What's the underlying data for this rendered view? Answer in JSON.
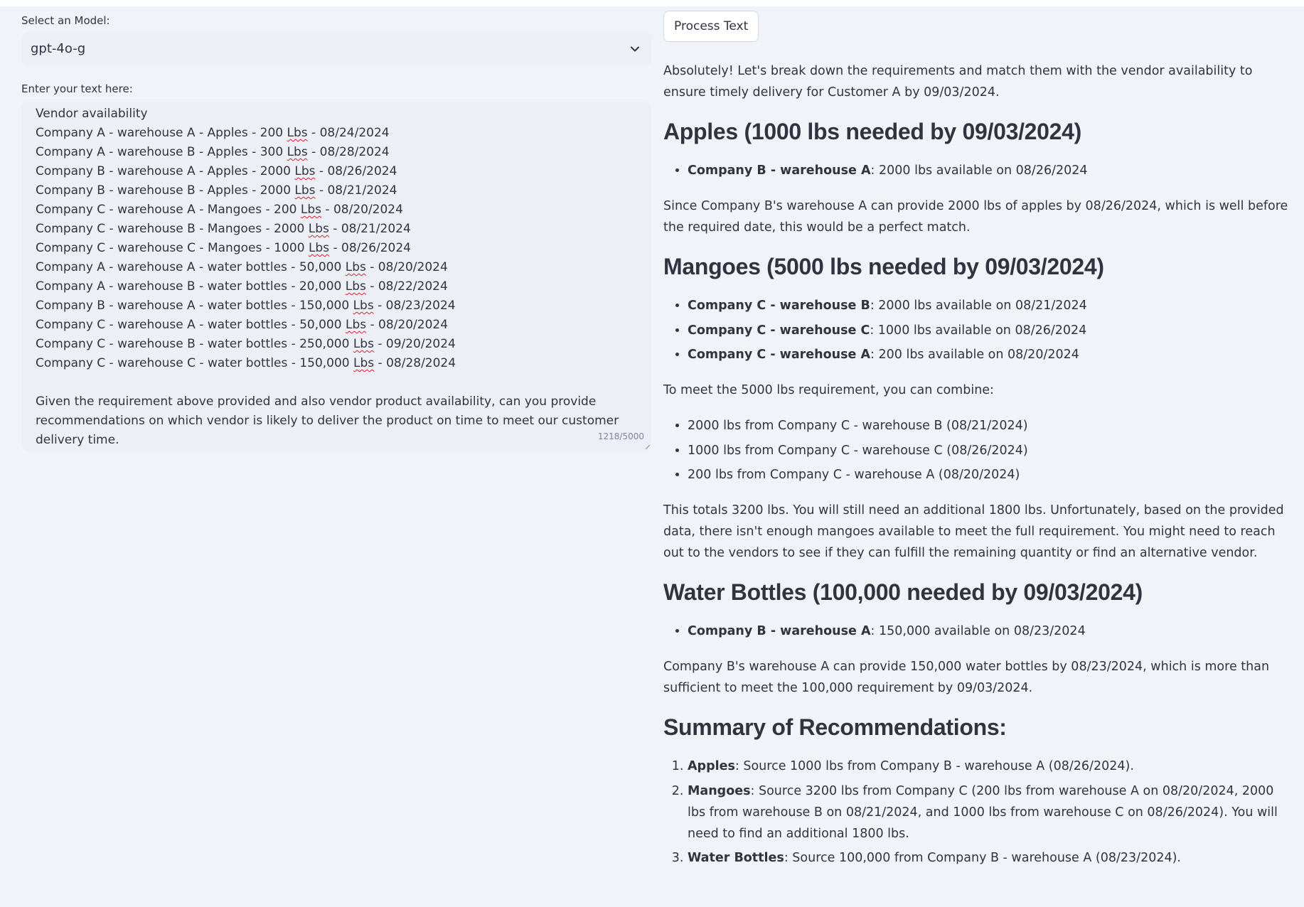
{
  "model": {
    "label": "Select an Model:",
    "selected": "gpt-4o-g"
  },
  "input": {
    "label": "Enter your text here:",
    "lines": [
      "Vendor availability",
      "Company A - warehouse A - Apples - 200 Lbs - 08/24/2024",
      "Company A - warehouse B - Apples - 300 Lbs - 08/28/2024",
      "Company B - warehouse A - Apples - 2000 Lbs - 08/26/2024",
      "Company B - warehouse B - Apples - 2000 Lbs - 08/21/2024",
      "Company C - warehouse A - Mangoes - 200 Lbs - 08/20/2024",
      "Company C - warehouse B - Mangoes - 2000 Lbs - 08/21/2024",
      "Company C - warehouse C - Mangoes - 1000 Lbs - 08/26/2024",
      "Company A - warehouse A - water bottles - 50,000 Lbs - 08/20/2024",
      "Company A - warehouse B - water bottles - 20,000 Lbs - 08/22/2024",
      "Company B - warehouse A - water bottles - 150,000 Lbs - 08/23/2024",
      "Company C - warehouse A - water bottles - 50,000 Lbs - 08/20/2024",
      "Company C - warehouse B - water bottles - 250,000 Lbs - 09/20/2024",
      "Company C - warehouse C - water bottles - 150,000 Lbs - 08/28/2024"
    ],
    "question": "Given the requirement above provided and also vendor product availability, can you provide recommendations on which vendor is likely to deliver the product on time to meet our customer delivery time.",
    "counter": "1218/5000"
  },
  "process_button": "Process Text",
  "response": {
    "intro": "Absolutely! Let's break down the requirements and match them with the vendor availability to ensure timely delivery for Customer A by 09/03/2024.",
    "apples": {
      "heading": "Apples (1000 lbs needed by 09/03/2024)",
      "items": [
        {
          "bold": "Company B - warehouse A",
          "rest": ": 2000 lbs available on 08/26/2024"
        }
      ],
      "note": "Since Company B's warehouse A can provide 2000 lbs of apples by 08/26/2024, which is well before the required date, this would be a perfect match."
    },
    "mangoes": {
      "heading": "Mangoes (5000 lbs needed by 09/03/2024)",
      "items": [
        {
          "bold": "Company C - warehouse B",
          "rest": ": 2000 lbs available on 08/21/2024"
        },
        {
          "bold": "Company C - warehouse C",
          "rest": ": 1000 lbs available on 08/26/2024"
        },
        {
          "bold": "Company C - warehouse A",
          "rest": ": 200 lbs available on 08/20/2024"
        }
      ],
      "combine_intro": "To meet the 5000 lbs requirement, you can combine:",
      "combine": [
        "2000 lbs from Company C - warehouse B (08/21/2024)",
        "1000 lbs from Company C - warehouse C (08/26/2024)",
        "200 lbs from Company C - warehouse A (08/20/2024)"
      ],
      "note": "This totals 3200 lbs. You will still need an additional 1800 lbs. Unfortunately, based on the provided data, there isn't enough mangoes available to meet the full requirement. You might need to reach out to the vendors to see if they can fulfill the remaining quantity or find an alternative vendor."
    },
    "water": {
      "heading": "Water Bottles (100,000 needed by 09/03/2024)",
      "items": [
        {
          "bold": "Company B - warehouse A",
          "rest": ": 150,000 available on 08/23/2024"
        }
      ],
      "note": "Company B's warehouse A can provide 150,000 water bottles by 08/23/2024, which is more than sufficient to meet the 100,000 requirement by 09/03/2024."
    },
    "summary": {
      "heading": "Summary of Recommendations:",
      "items": [
        {
          "bold": "Apples",
          "rest": ": Source 1000 lbs from Company B - warehouse A (08/26/2024)."
        },
        {
          "bold": "Mangoes",
          "rest": ": Source 3200 lbs from Company C (200 lbs from warehouse A on 08/20/2024, 2000 lbs from warehouse B on 08/21/2024, and 1000 lbs from warehouse C on 08/26/2024). You will need to find an additional 1800 lbs."
        },
        {
          "bold": "Water Bottles",
          "rest": ": Source 100,000 from Company B - warehouse A (08/23/2024)."
        }
      ]
    }
  }
}
